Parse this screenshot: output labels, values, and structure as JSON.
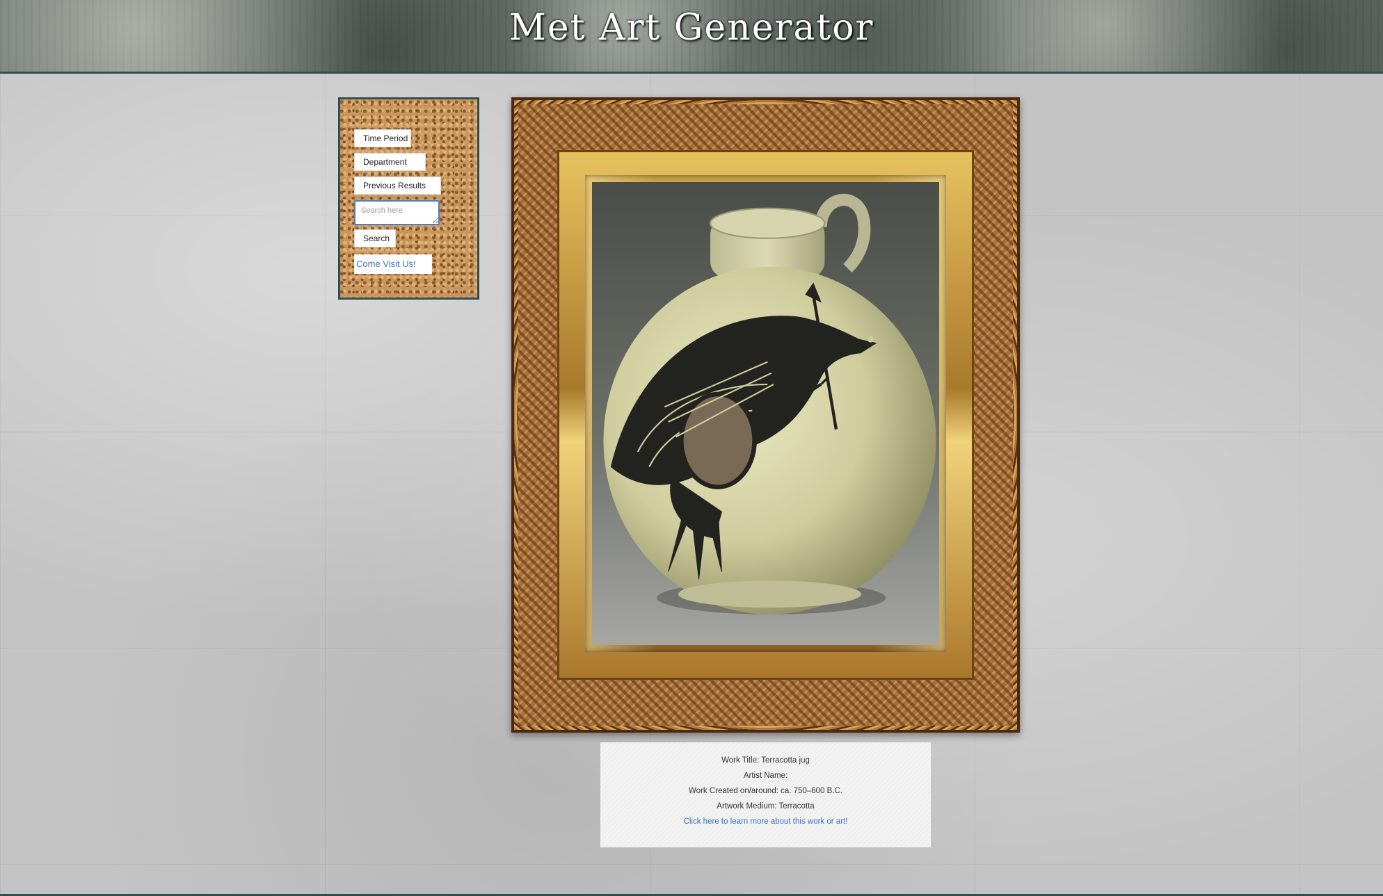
{
  "header": {
    "title": "Met Art Generator"
  },
  "sidebar": {
    "time_period_label": "Time Period",
    "department_label": "Department",
    "previous_results_label": "Previous Results",
    "search_placeholder": "Search here",
    "search_value": "",
    "search_button_label": "Search",
    "visit_link_label": "Come Visit Us!"
  },
  "artwork": {
    "subject": "Terracotta jug painted with a bird",
    "info": {
      "title_line": "Work Title: Terracotta jug",
      "artist_line": "Artist Name:",
      "date_line": "Work Created on/around: ca. 750–600 B.C.",
      "medium_line": "Artwork Medium: Terracotta",
      "link_label": "Click here to learn more about this work or art!"
    }
  },
  "colors": {
    "header_border": "#2f4f4f",
    "link": "#3b6fc4",
    "wall": "#c4c4c4",
    "cork": "#c8955c",
    "gold": "#c9a04a"
  },
  "icons": [
    "resize-handle-icon"
  ]
}
